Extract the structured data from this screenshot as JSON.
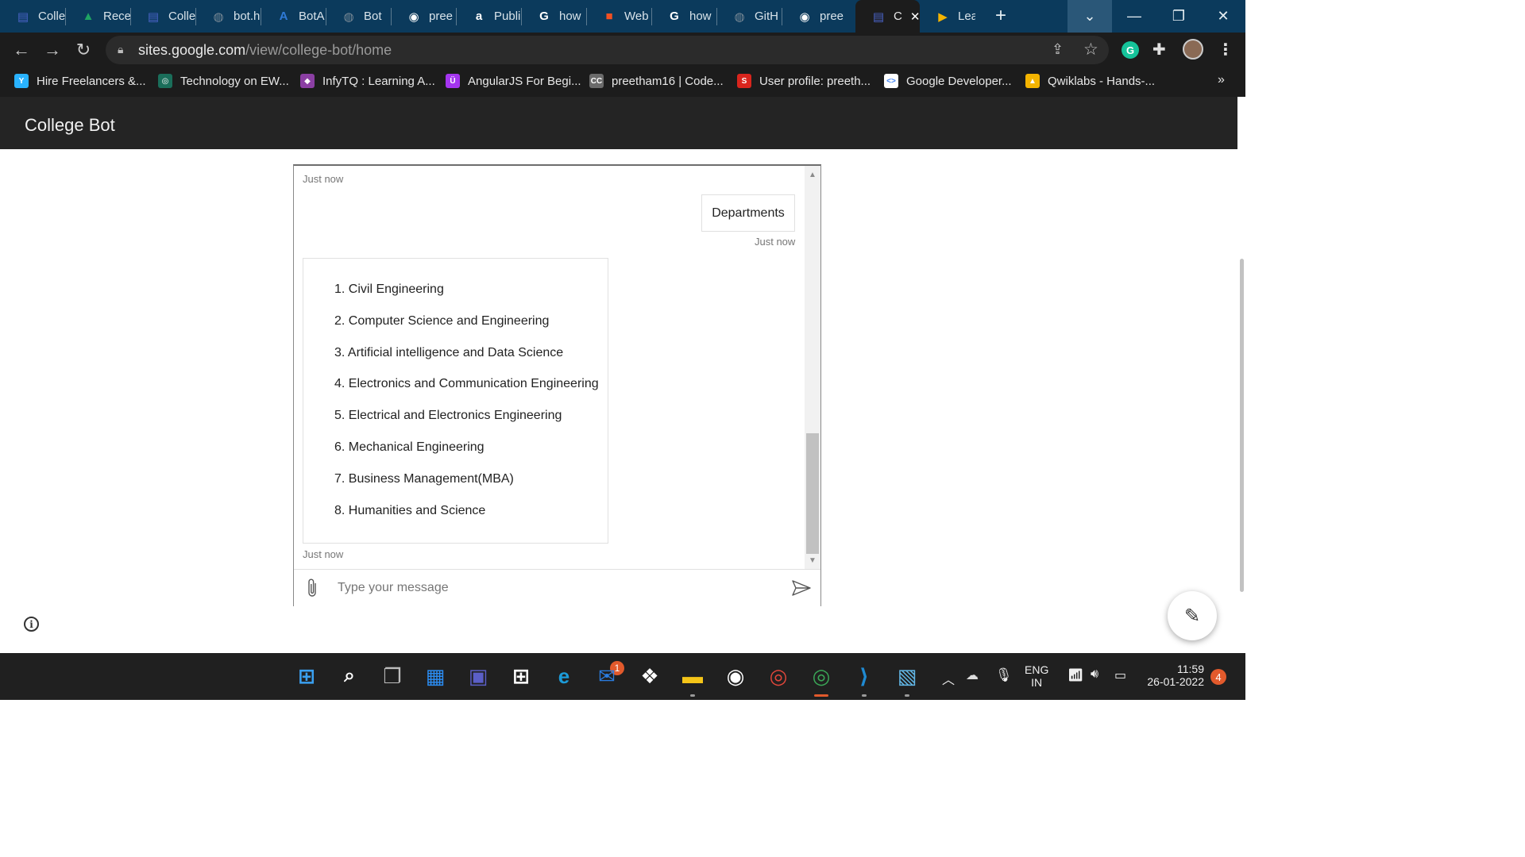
{
  "browser": {
    "tabs": [
      {
        "label": "Colle",
        "icon": "google-sites-icon",
        "color": "#4a63c8"
      },
      {
        "label": "Rece",
        "icon": "google-drive-icon",
        "color": "#1fa463"
      },
      {
        "label": "Colle",
        "icon": "google-sites-icon",
        "color": "#4a63c8"
      },
      {
        "label": "bot.h",
        "icon": "globe-icon",
        "color": "#7a8a96"
      },
      {
        "label": "BotA",
        "icon": "azure-icon",
        "color": "#2f7bd8"
      },
      {
        "label": "Bot",
        "icon": "globe-icon",
        "color": "#7a8a96"
      },
      {
        "label": "pree",
        "icon": "github-icon",
        "color": "#ffffff"
      },
      {
        "label": "Publi",
        "icon": "at-icon",
        "color": "#ffffff"
      },
      {
        "label": "how",
        "icon": "google-icon",
        "color": "#ffffff"
      },
      {
        "label": "Web",
        "icon": "microsoft-icon",
        "color": "#f25022"
      },
      {
        "label": "how",
        "icon": "google-icon",
        "color": "#ffffff"
      },
      {
        "label": "GitH",
        "icon": "globe-icon",
        "color": "#7a8a96"
      },
      {
        "label": "pree",
        "icon": "github-icon",
        "color": "#ffffff"
      },
      {
        "label": "C",
        "icon": "google-sites-icon",
        "color": "#4a63c8"
      },
      {
        "label": "Learr",
        "icon": "play-icon",
        "color": "#f5b400"
      }
    ],
    "active_tab_index": 13,
    "new_tab": "+",
    "url_host": "sites.google.com",
    "url_path": "/view/college-bot/home",
    "bookmarks": [
      {
        "label": "Hire Freelancers &...",
        "icon": "freelancer-icon",
        "color": "#29b2fe"
      },
      {
        "label": "Technology on EW...",
        "icon": "ew-icon",
        "color": "#1a6e5a"
      },
      {
        "label": "InfyTQ : Learning A...",
        "icon": "infytq-icon",
        "color": "#8b3fa3"
      },
      {
        "label": "AngularJS For Begi...",
        "icon": "udemy-icon",
        "color": "#a435f0"
      },
      {
        "label": "preetham16 | Code...",
        "icon": "codechef-icon",
        "color": "#6b6b6b"
      },
      {
        "label": "User profile: preeth...",
        "icon": "spoj-icon",
        "color": "#d9251d"
      },
      {
        "label": "Google Developer...",
        "icon": "google-developers-icon",
        "color": "#ffffff"
      },
      {
        "label": "Qwiklabs - Hands-...",
        "icon": "qwiklabs-icon",
        "color": "#f4b400"
      }
    ],
    "bookmarks_overflow": "»"
  },
  "site": {
    "title": "College Bot"
  },
  "chat": {
    "timestamp_top": "Just now",
    "user_message": "Departments",
    "user_timestamp": "Just now",
    "bot_departments": [
      "1. Civil Engineering",
      "2. Computer Science and Engineering",
      "3. Artificial intelligence and Data Science",
      "4. Electronics and Communication Engineering",
      "5. Electrical and Electronics Engineering",
      "6. Mechanical Engineering",
      "7. Business Management(MBA)",
      "8. Humanities and Science"
    ],
    "bot_timestamp": "Just now",
    "input_placeholder": "Type your message"
  },
  "taskbar": {
    "apps": [
      {
        "name": "windows-start-icon",
        "color": "#3aa0f0"
      },
      {
        "name": "search-icon",
        "color": "#ffffff"
      },
      {
        "name": "task-view-icon",
        "color": "#bdbdbd"
      },
      {
        "name": "widgets-icon",
        "color": "#2b8ef5"
      },
      {
        "name": "teams-chat-icon",
        "color": "#5b5fc7"
      },
      {
        "name": "microsoft-store-icon",
        "color": "#ffffff"
      },
      {
        "name": "edge-icon",
        "color": "#1c9bd8"
      },
      {
        "name": "mail-icon",
        "color": "#2a7de1"
      },
      {
        "name": "dropbox-icon",
        "color": "#ffffff"
      },
      {
        "name": "file-explorer-icon",
        "color": "#f5c518"
      },
      {
        "name": "github-desktop-icon",
        "color": "#ffffff"
      },
      {
        "name": "chrome-icon",
        "color": "#e0463a"
      },
      {
        "name": "chrome-profile-icon",
        "color": "#3aa757"
      },
      {
        "name": "vscode-icon",
        "color": "#1f8ad2"
      },
      {
        "name": "virtualbox-icon",
        "color": "#62b8e8"
      }
    ],
    "mail_badge": "1",
    "language": "ENG",
    "region": "IN",
    "time": "11:59",
    "date": "26-01-2022",
    "notification_count": "4"
  }
}
